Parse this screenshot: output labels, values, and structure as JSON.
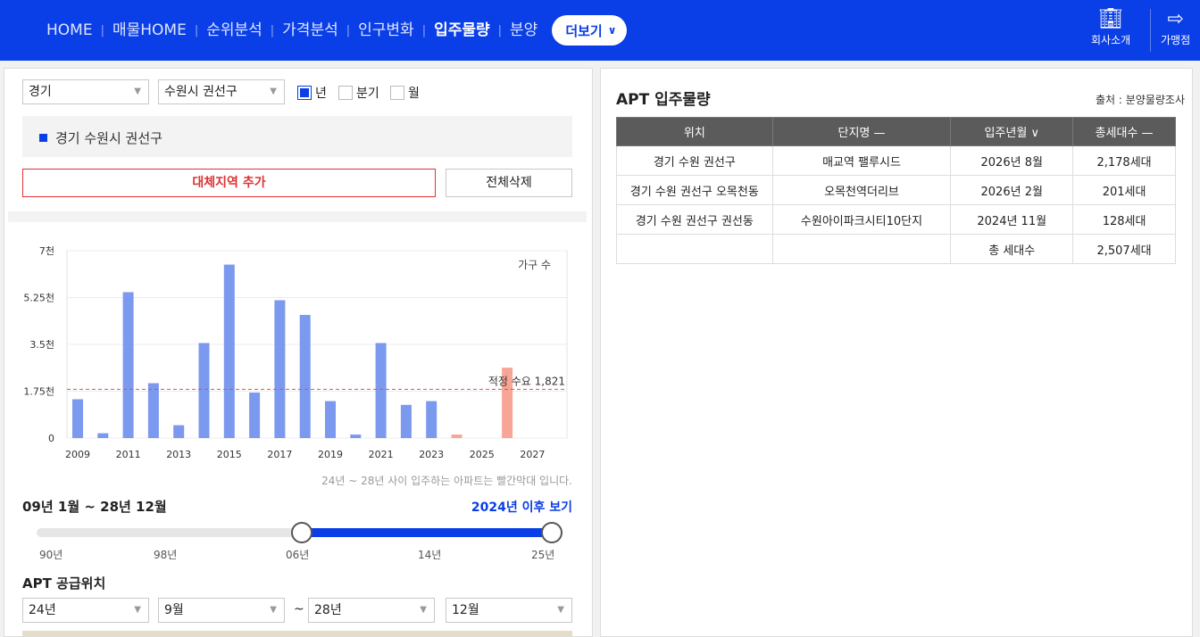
{
  "nav": {
    "items": [
      "HOME",
      "매물HOME",
      "순위분석",
      "가격분석",
      "인구변화",
      "입주물량",
      "분양"
    ],
    "active": "입주물량",
    "more": "더보기",
    "company": "회사소개",
    "join": "가맹점"
  },
  "filters": {
    "province": "경기",
    "district": "수원시 권선구",
    "period_year": "년",
    "period_quarter": "분기",
    "period_month": "월"
  },
  "selected_region": "경기 수원시 권선구",
  "buttons": {
    "add_alt": "대체지역 추가",
    "delete_all": "전체삭제"
  },
  "chart_data": {
    "type": "bar",
    "categories": [
      "2009",
      "2010",
      "2011",
      "2012",
      "2013",
      "2014",
      "2015",
      "2016",
      "2017",
      "2018",
      "2019",
      "2020",
      "2021",
      "2022",
      "2023",
      "2024",
      "2025",
      "2026",
      "2027"
    ],
    "values": [
      1450,
      180,
      5450,
      2050,
      480,
      3550,
      6480,
      1700,
      5150,
      4600,
      1380,
      130,
      3550,
      1240,
      1380,
      130,
      0,
      2630,
      0
    ],
    "highlight_from": "2024",
    "colors": {
      "normal": "#7b99ee",
      "future": "#f7a597",
      "demand_line": "#e05050"
    },
    "xticks": [
      "2009",
      "2011",
      "2013",
      "2015",
      "2017",
      "2019",
      "2021",
      "2023",
      "2025",
      "2027"
    ],
    "yticks": [
      "0",
      "1.75천",
      "3.5천",
      "5.25천",
      "7천"
    ],
    "ylim": [
      0,
      7000
    ],
    "legend": "가구 수",
    "demand_label": "적정 수요 1,821",
    "demand_value": 1821
  },
  "chart_note": "24년 ~ 28년 사이 입주하는 아파트는 빨간막대 입니다.",
  "range": {
    "label": "09년 1월 ~ 28년 12월",
    "after_link": "2024년 이후 보기",
    "ticks": [
      "90년",
      "98년",
      "06년",
      "14년",
      "25년"
    ]
  },
  "supply": {
    "title": "APT 공급위치",
    "from_year": "24년",
    "from_month": "9월",
    "tilde": "~",
    "to_year": "28년",
    "to_month": "12월"
  },
  "right": {
    "title": "APT 입주물량",
    "source": "출처 : 분양물량조사",
    "headers": [
      "위치",
      "단지명 —",
      "입주년월 ∨",
      "총세대수 —"
    ],
    "rows": [
      [
        "경기 수원 권선구",
        "매교역 팰루시드",
        "2026년 8월",
        "2,178세대"
      ],
      [
        "경기 수원 권선구 오목천동",
        "오목천역더리브",
        "2026년 2월",
        "201세대"
      ],
      [
        "경기 수원 권선구 권선동",
        "수원아이파크시티10단지",
        "2024년 11월",
        "128세대"
      ]
    ],
    "total_label": "총 세대수",
    "total_value": "2,507세대"
  }
}
